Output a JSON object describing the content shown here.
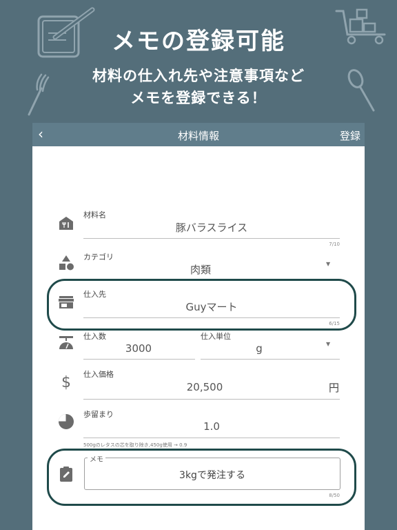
{
  "promo": {
    "title": "メモの登録可能",
    "subtitle_line1": "材料の仕入れ先や注意事項など",
    "subtitle_line2": "メモを登録できる！"
  },
  "appbar": {
    "back_label": "‹",
    "title": "材料情報",
    "save_label": "登録"
  },
  "form": {
    "name": {
      "label": "材料名",
      "value": "豚バラスライス",
      "counter": "7/10",
      "icon": "store-icon"
    },
    "category": {
      "label": "カテゴリ",
      "value": "肉類",
      "icon": "shapes-icon"
    },
    "supplier": {
      "label": "仕入先",
      "value": "Guyマート",
      "counter": "6/15",
      "icon": "shop-front-icon"
    },
    "purchase_qty": {
      "label": "仕入数",
      "value": "3000",
      "icon": "scale-icon"
    },
    "purchase_unit": {
      "label": "仕入単位",
      "value": "g"
    },
    "price": {
      "label": "仕入価格",
      "value": "20,500",
      "unit": "円",
      "icon": "dollar-icon"
    },
    "yield": {
      "label": "歩留まり",
      "value": "1.0",
      "hint": "500gのレタスの芯を取り除き,450g使用 → 0.9",
      "icon": "pie-icon"
    },
    "memo": {
      "label": "メモ",
      "value": "3kgで発注する",
      "counter": "8/50",
      "icon": "clipboard-edit-icon"
    }
  },
  "colors": {
    "background": "#546e7a",
    "appbar": "#607d8b",
    "highlight_ring": "#1f4a4a",
    "icon": "#6b6b6b"
  }
}
